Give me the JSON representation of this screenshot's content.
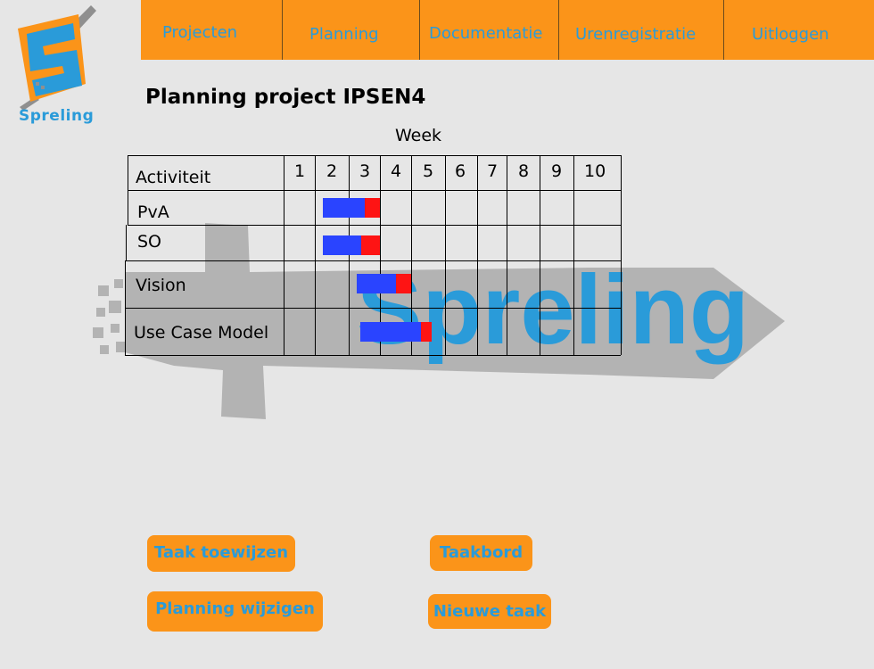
{
  "logo": {
    "text": "Spreling",
    "icon": "spreling-s-logo"
  },
  "nav": {
    "items": [
      {
        "label": "Projecten"
      },
      {
        "label": "Planning"
      },
      {
        "label": "Documentatie"
      },
      {
        "label": "Urenregistratie"
      },
      {
        "label": "Uitloggen"
      }
    ]
  },
  "page": {
    "title": "Planning project IPSEN4"
  },
  "watermark": {
    "text": "Spreling"
  },
  "gantt": {
    "week_label": "Week",
    "activity_header": "Activiteit",
    "weeks": [
      "1",
      "2",
      "3",
      "4",
      "5",
      "6",
      "7",
      "8",
      "9",
      "10"
    ],
    "activities": [
      {
        "name": "PvA",
        "planned_weeks": [
          1,
          2.5
        ],
        "extra_weeks": [
          2.5,
          3
        ]
      },
      {
        "name": "SO",
        "planned_weeks": [
          1,
          2.4
        ],
        "extra_weeks": [
          2.4,
          3
        ]
      },
      {
        "name": "Vision",
        "planned_weeks": [
          2,
          3.5
        ],
        "extra_weeks": [
          3.5,
          4
        ]
      },
      {
        "name": "Use Case Model",
        "planned_weeks": [
          2.1,
          4.3
        ],
        "extra_weeks": [
          4.3,
          4.6
        ]
      }
    ],
    "colors": {
      "planned": "#2a44ff",
      "extra": "#fe1414"
    }
  },
  "buttons": {
    "assign_task": "Taak toewijzen",
    "task_board": "Taakbord",
    "change_planning": "Planning wijzigen",
    "new_task": "Nieuwe taak"
  },
  "colors": {
    "accent": "#fb9419",
    "text_accent": "#2a9bd9",
    "background": "#e6e6e6"
  }
}
